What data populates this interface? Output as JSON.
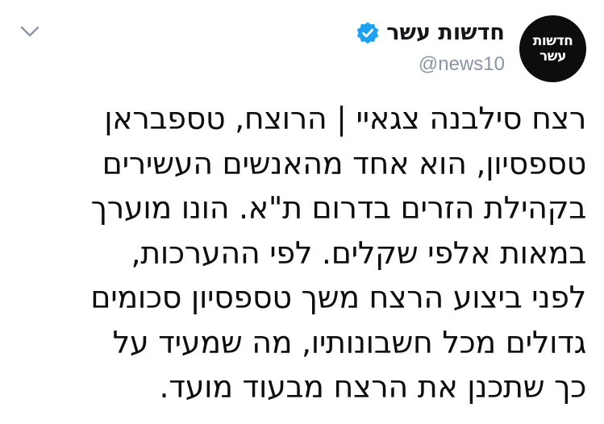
{
  "account": {
    "display_name": "חדשות עשר",
    "handle": "@news10",
    "avatar_line1": "חדשות",
    "avatar_line2": "עשר",
    "verified": true
  },
  "icons": {
    "verified": "verified-badge-icon",
    "menu": "chevron-down-icon"
  },
  "colors": {
    "verified_blue": "#1da1f2",
    "handle_gray": "#8a96a3",
    "avatar_bg": "#0d0d0d"
  },
  "tweet": {
    "lines": [
      "רצח סילבנה צגאיי | הרוצח, טספבראן",
      "טספסיון, הוא אחד מהאנשים העשירים",
      "בקהילת הזרים בדרום ת\"א. הונו מוערך",
      "במאות אלפי שקלים. לפי ההערכות,",
      "לפני ביצוע הרצח משך טספסיון סכומים",
      "גדולים מכל חשבונותיו, מה שמעיד על",
      "כך שתכנן את הרצח מבעוד מועד."
    ]
  }
}
